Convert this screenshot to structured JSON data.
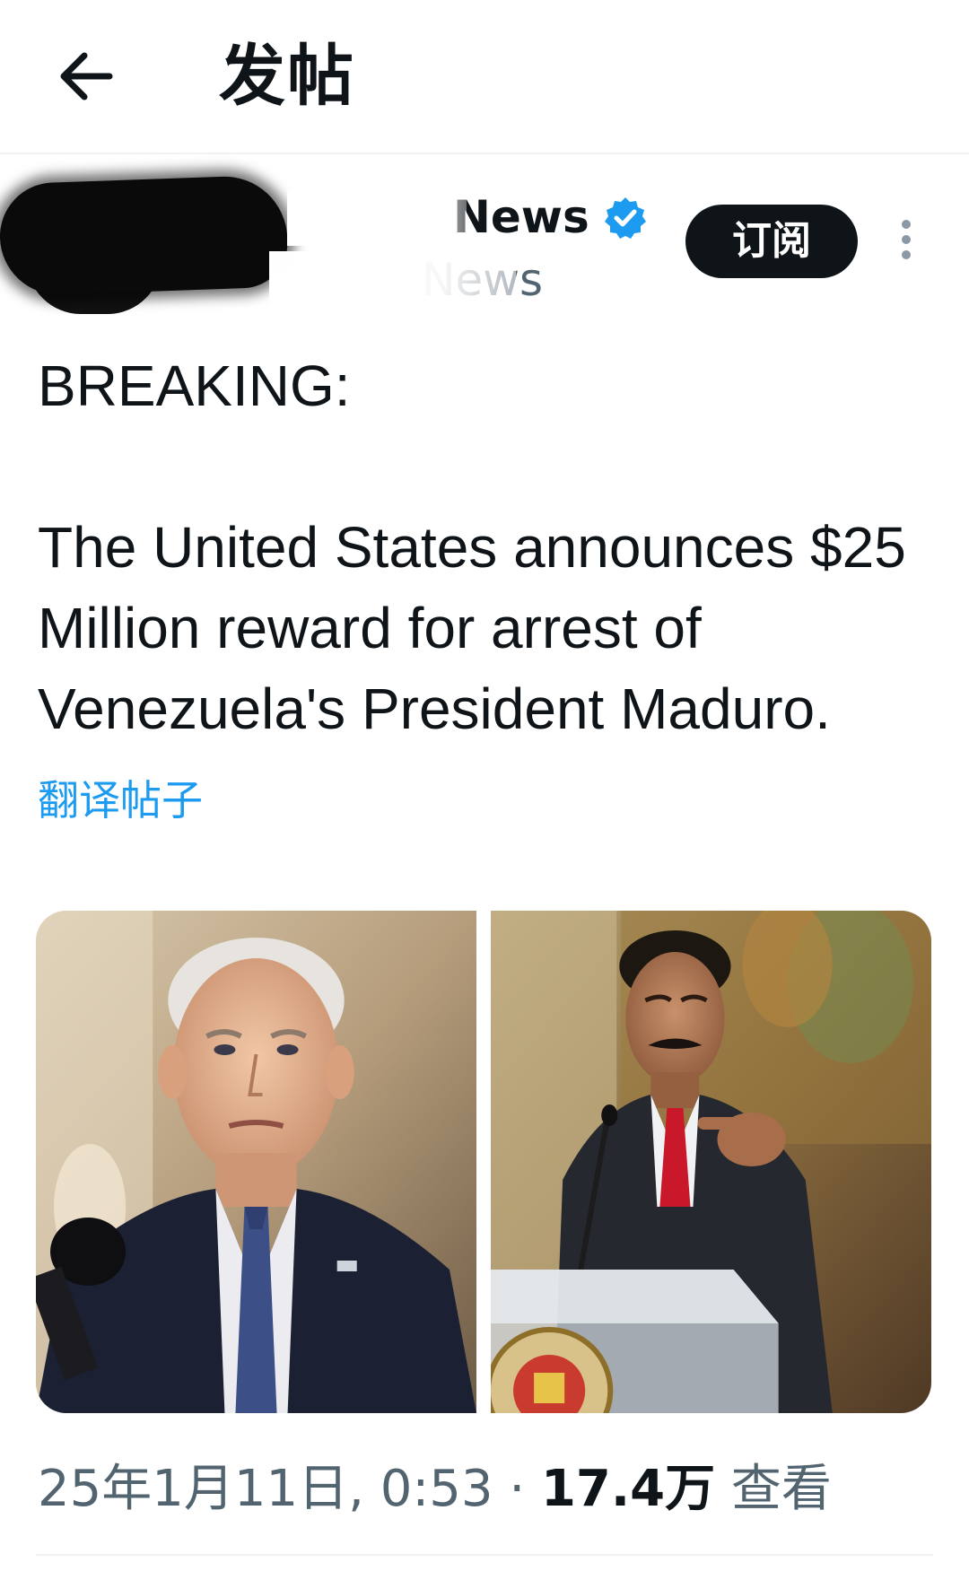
{
  "header": {
    "title": "发帖",
    "back_icon": "arrow-left-icon"
  },
  "author": {
    "name": "News",
    "handle": "News",
    "verified": true,
    "verified_color": "#1d9bf0",
    "subscribe_label": "订阅",
    "more_icon": "more-vertical-icon"
  },
  "tweet": {
    "line1": "BREAKING:",
    "line2": "The United States announces $25 Million reward for arrest of Venezuela's President Maduro.",
    "translate_label": "翻译帖子"
  },
  "media": [
    {
      "alt": "photo-left"
    },
    {
      "alt": "photo-right"
    }
  ],
  "meta": {
    "timestamp": "25年1月11日, 0:53",
    "separator": "·",
    "views_count": "17.4万",
    "views_label": "查看"
  },
  "colors": {
    "accent": "#1d9bf0",
    "text": "#0f1419",
    "secondary": "#536471"
  }
}
